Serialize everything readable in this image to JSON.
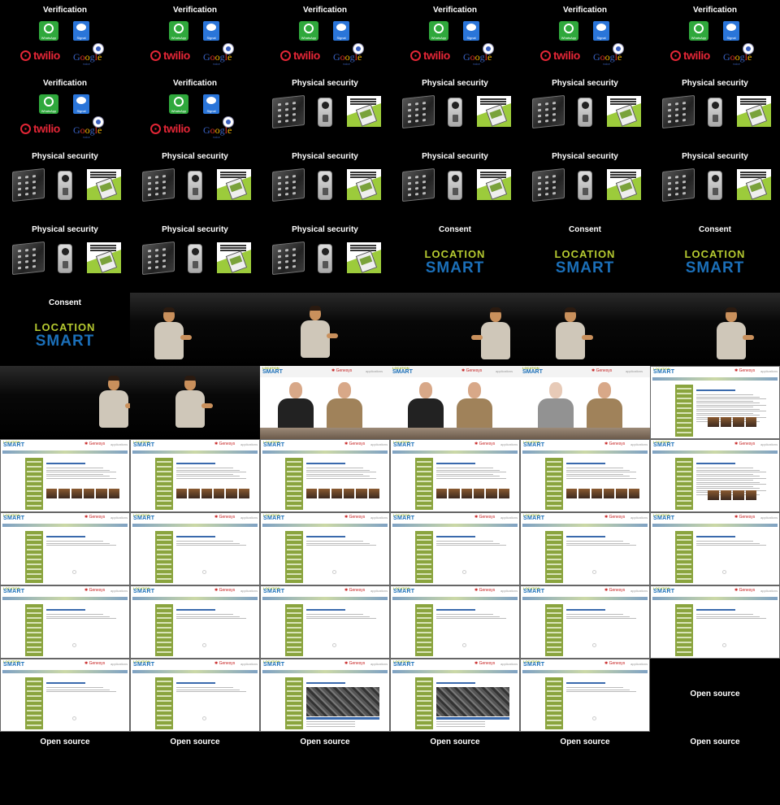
{
  "grid": {
    "rows": [
      [
        "verification",
        "verification",
        "verification",
        "verification",
        "verification",
        "verification"
      ],
      [
        "verification",
        "verification",
        "physical",
        "physical",
        "physical",
        "physical"
      ],
      [
        "physical",
        "physical",
        "physical",
        "physical",
        "physical",
        "physical"
      ],
      [
        "physical",
        "physical",
        "physical",
        "consent",
        "consent",
        "consent"
      ],
      [
        "consent",
        "speaker-a",
        "speaker-b",
        "speaker-c",
        "speaker-d",
        "speaker-e"
      ],
      [
        "speaker-f",
        "speaker-g",
        "video",
        "video",
        "video-dim",
        "web-text"
      ],
      [
        "web-thumbs",
        "web-thumbs",
        "web-thumbs",
        "web-thumbs",
        "web-thumbs",
        "web-text"
      ],
      [
        "web-blank",
        "web-blank",
        "web-blank",
        "web-blank",
        "web-blank",
        "web-blank"
      ],
      [
        "web-blank",
        "web-blank",
        "web-blank",
        "web-blank",
        "web-blank",
        "web-blank"
      ],
      [
        "web-blank",
        "web-blank",
        "web-board",
        "web-board",
        "web-blank",
        "opensource-mid"
      ],
      [
        "opensource",
        "opensource",
        "opensource",
        "opensource",
        "opensource",
        "opensource"
      ]
    ]
  },
  "labels": {
    "verification": "Verification",
    "physical": "Physical security",
    "consent": "Consent",
    "opensource": "Open source"
  },
  "logos": {
    "whatsapp": "WhatsApp",
    "signal": "Signal",
    "twilio": "twilio",
    "google_voice_sub": "voice",
    "location": "LOCATION",
    "smart": "SMART",
    "genesys": "Genesys",
    "genesys_sub": "applications"
  },
  "colors": {
    "background": "#000000",
    "title_text": "#ffffff",
    "whatsapp_green": "#2fa83c",
    "signal_blue": "#2a75d9",
    "twilio_red": "#e32636",
    "location_lime": "#b5c930",
    "smart_blue": "#1b6fb8",
    "site_green": "#8aa43e"
  },
  "icons": [
    "whatsapp-icon",
    "signal-icon",
    "twilio-logo",
    "google-voice-logo",
    "phone-icon",
    "keypad-icon",
    "door-camera-icon",
    "phone-card-icon"
  ]
}
